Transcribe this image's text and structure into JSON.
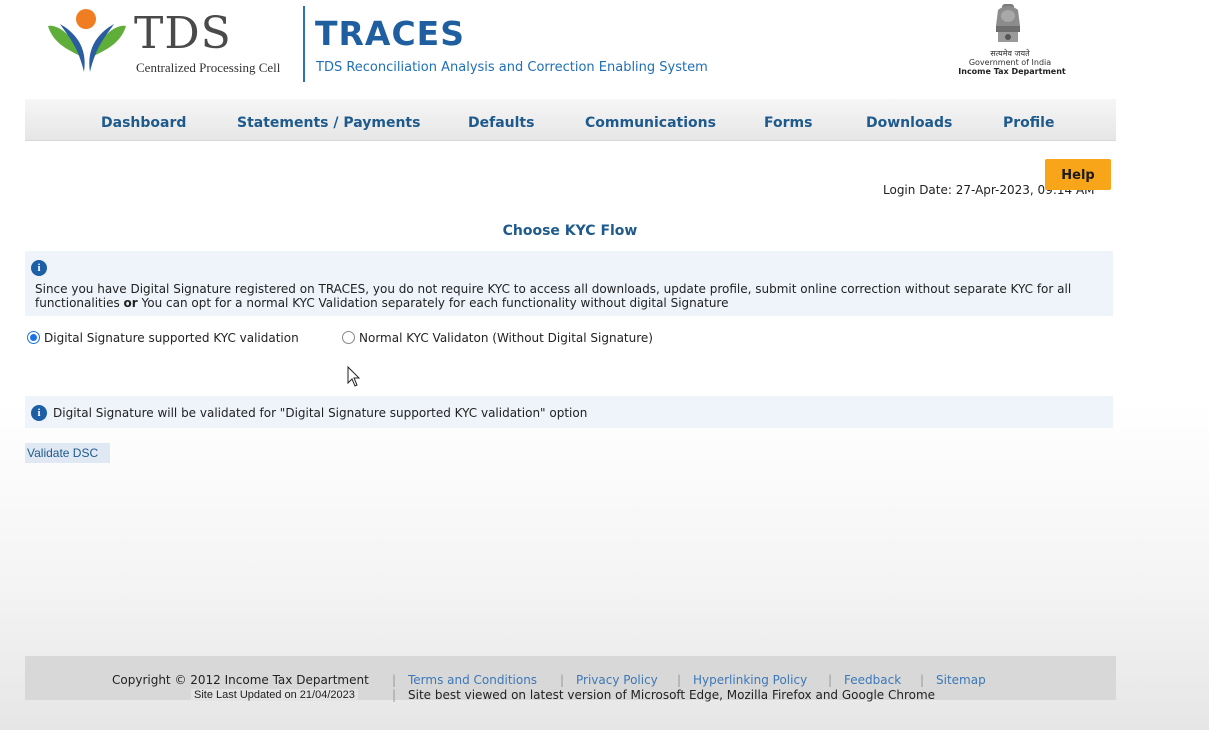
{
  "header": {
    "tds_word": "TDS",
    "tds_sub": "Centralized Processing Cell",
    "traces_word": "TRACES",
    "traces_sub": "TDS Reconciliation Analysis and Correction Enabling System",
    "gov_hindi": "सत्यमेव जयते",
    "gov_line": "Government of India",
    "dept_line": "Income Tax Department"
  },
  "nav": {
    "items": [
      "Dashboard",
      "Statements / Payments",
      "Defaults",
      "Communications",
      "Forms",
      "Downloads",
      "Profile"
    ]
  },
  "help_label": "Help",
  "login_date": "Login Date: 27-Apr-2023, 09:14 AM",
  "page_title": "Choose KYC Flow",
  "info": {
    "text_part1": "Since you have Digital Signature registered on TRACES, you do not require KYC to access all downloads, update profile, submit online correction without separate KYC for all functionalities ",
    "text_bold": "or",
    "text_part2": " You can opt for a normal KYC Validation separately for each functionality without digital Signature",
    "note": "Digital Signature will be validated for \"Digital Signature supported KYC validation\" option"
  },
  "options": [
    {
      "label": "Digital Signature supported KYC validation",
      "selected": true
    },
    {
      "label": "Normal KYC Validaton (Without Digital Signature)",
      "selected": false
    }
  ],
  "validate_label": "Validate DSC",
  "footer": {
    "copyright": "Copyright © 2012 Income Tax Department",
    "updated": "Site Last Updated on 21/04/2023",
    "links": [
      "Terms and Conditions",
      "Privacy Policy",
      "Hyperlinking Policy",
      "Feedback",
      "Sitemap"
    ],
    "best_view": "Site best viewed on latest version of Microsoft Edge, Mozilla Firefox and Google Chrome"
  },
  "colors": {
    "brand_blue": "#1f5fa0",
    "help_orange": "#f8a51a",
    "info_bg": "#eef4fa"
  }
}
